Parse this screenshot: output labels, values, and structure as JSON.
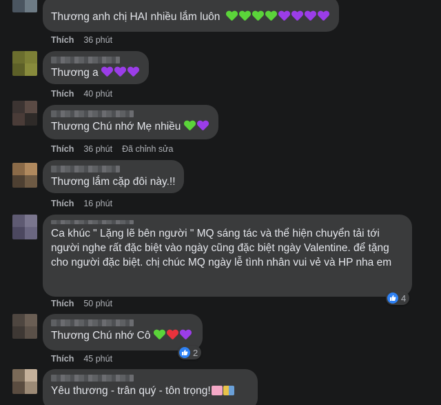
{
  "comments": [
    {
      "text": "Thương anh chị HAI nhiều lắm luôn ",
      "hearts": [
        "green",
        "green",
        "green",
        "green",
        "purple",
        "purple",
        "purple",
        "purple"
      ],
      "like_label": "Thích",
      "time": "36 phút"
    },
    {
      "text": "Thương a ",
      "hearts": [
        "purple",
        "purple",
        "purple"
      ],
      "like_label": "Thích",
      "time": "40 phút"
    },
    {
      "text": "Thương Chú nhớ Mẹ nhiều ",
      "hearts": [
        "green",
        "purple"
      ],
      "like_label": "Thích",
      "time": "36 phút",
      "edited": "Đã chỉnh sửa"
    },
    {
      "text": "Thương lắm cặp đôi này.!!",
      "like_label": "Thích",
      "time": "16 phút"
    },
    {
      "text": "Ca khúc \" Lặng lẽ bên người \" MQ sáng tác và thể hiện chuyển tải tới người nghe rất đặc biệt vào ngày cũng đặc biệt ngày Valentine. để tặng cho người đặc biệt. chị chúc MQ ngày lễ tình nhân vui vẻ và HP nha em",
      "like_label": "Thích",
      "time": "50 phút",
      "reaction_count": "4"
    },
    {
      "text": "Thương Chú nhớ Cô ",
      "hearts": [
        "green",
        "red",
        "purple"
      ],
      "like_label": "Thích",
      "time": "45 phút",
      "reaction_count": "2"
    },
    {
      "text": "Yêu thương - trân quý - tôn trọng!"
    }
  ],
  "colors": {
    "green": "#5bd43a",
    "purple": "#9b3de8",
    "red": "#e8323c",
    "bubble": "#3a3b3c",
    "background": "#18191a",
    "like_blue": "#2e81f4"
  }
}
